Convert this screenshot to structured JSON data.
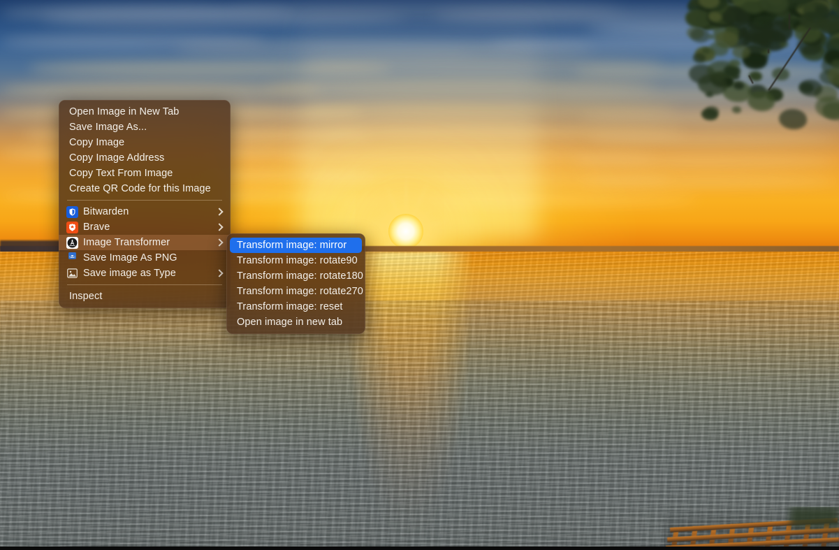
{
  "background": {
    "scene_description": "Sunset over a lake with sun on the horizon, golden clouds, blue sky, tree foliage at upper right and a wooden dock at lower right",
    "colors": {
      "sky_top": "#1f3f6e",
      "sky_horizon": "#f9b021",
      "sun_core": "#ffffff",
      "water_far": "#f0920f",
      "water_near": "#656c6b",
      "tree": "#23301f",
      "dock": "#c97a28"
    }
  },
  "context_menu": {
    "name": "image-context-menu",
    "groups": [
      {
        "id": "group-standard",
        "items": [
          {
            "label": "Open Image in New Tab",
            "icon": null,
            "submenu": false,
            "highlighted": false
          },
          {
            "label": "Save Image As...",
            "icon": null,
            "submenu": false,
            "highlighted": false
          },
          {
            "label": "Copy Image",
            "icon": null,
            "submenu": false,
            "highlighted": false
          },
          {
            "label": "Copy Image Address",
            "icon": null,
            "submenu": false,
            "highlighted": false
          },
          {
            "label": "Copy Text From Image",
            "icon": null,
            "submenu": false,
            "highlighted": false
          },
          {
            "label": "Create QR Code for this Image",
            "icon": null,
            "submenu": false,
            "highlighted": false
          }
        ]
      },
      {
        "id": "group-extensions",
        "items": [
          {
            "label": "Bitwarden",
            "icon": "bitwarden-icon",
            "submenu": true,
            "highlighted": false
          },
          {
            "label": "Brave",
            "icon": "brave-icon",
            "submenu": true,
            "highlighted": false
          },
          {
            "label": "Image Transformer",
            "icon": "image-transformer-icon",
            "submenu": true,
            "highlighted": true
          },
          {
            "label": "Save Image As PNG",
            "icon": "save-png-icon",
            "submenu": false,
            "highlighted": false
          },
          {
            "label": "Save image as Type",
            "icon": "save-as-type-icon",
            "submenu": true,
            "highlighted": false
          }
        ]
      },
      {
        "id": "group-inspect",
        "items": [
          {
            "label": "Inspect",
            "icon": null,
            "submenu": false,
            "highlighted": false
          }
        ]
      }
    ]
  },
  "submenu": {
    "name": "image-transformer-submenu",
    "parent": "Image Transformer",
    "items": [
      {
        "label": "Transform image: mirror",
        "highlighted": true
      },
      {
        "label": "Transform image: rotate90",
        "highlighted": false
      },
      {
        "label": "Transform image: rotate180",
        "highlighted": false
      },
      {
        "label": "Transform image: rotate270",
        "highlighted": false
      },
      {
        "label": "Transform image: reset",
        "highlighted": false
      },
      {
        "label": "Open image in new tab",
        "highlighted": false
      }
    ]
  },
  "theme": {
    "menu_background": "rgba(74,48,30,0.80)",
    "menu_text": "#f3efe9",
    "highlight_blue": "#1f6fec",
    "highlight_brown": "rgba(156,101,59,0.60)",
    "separator": "rgba(255,236,205,0.30)"
  }
}
